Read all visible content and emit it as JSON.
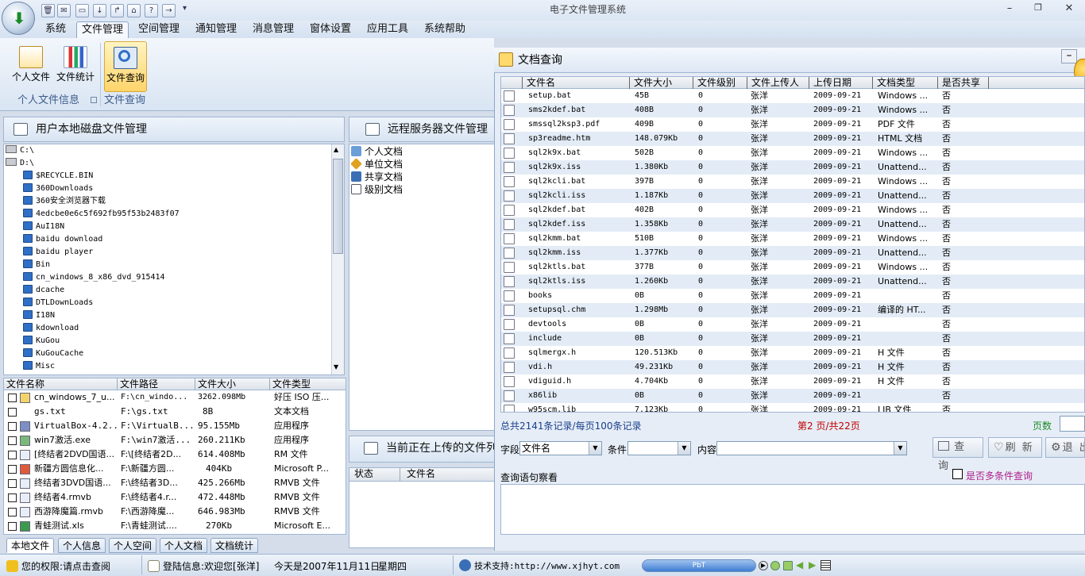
{
  "app": {
    "title": "电子文件管理系统"
  },
  "menu": [
    "系统",
    "文件管理",
    "空间管理",
    "通知管理",
    "消息管理",
    "窗体设置",
    "应用工具",
    "系统帮助"
  ],
  "ribbon": {
    "buttons": {
      "personal": "个人文件",
      "stats": "文件统计",
      "query": "文件查询"
    },
    "groups": {
      "personal_info": "个人文件信息",
      "query": "文件查询"
    }
  },
  "local_panel": {
    "title": "用户本地磁盘文件管理",
    "drives": [
      "C:\\",
      "D:\\"
    ],
    "folders": [
      "$RECYCLE.BIN",
      "360Downloads",
      "360安全浏览器下载",
      "4edcbe0e6c5f692fb95f53b2483f07",
      "AuI18N",
      "baidu download",
      "baidu player",
      "Bin",
      "cn_windows_8_x86_dvd_915414",
      "dcache",
      "DTLDownLoads",
      "I18N",
      "kdownload",
      "KuGou",
      "KuGouCache",
      "Misc"
    ],
    "columns": [
      "文件名称",
      "文件路径",
      "文件大小",
      "文件类型"
    ],
    "files": [
      {
        "name": "cn_windows_7_u...",
        "path": "F:\\cn_windo...",
        "size": "3262.098Mb",
        "type": "好压 ISO 压..."
      },
      {
        "name": "gs.txt",
        "path": "F:\\gs.txt",
        "size": "8B",
        "type": "文本文档"
      },
      {
        "name": "VirtualBox-4.2...",
        "path": "F:\\VirtualB...",
        "size": "95.155Mb",
        "type": "应用程序"
      },
      {
        "name": "win7激活.exe",
        "path": "F:\\win7激活...",
        "size": "260.211Kb",
        "type": "应用程序"
      },
      {
        "name": "[终结者2DVD国语...",
        "path": "F:\\[终结者2D...",
        "size": "614.408Mb",
        "type": "RM 文件"
      },
      {
        "name": "新疆方圆信息化...",
        "path": "F:\\新疆方圆...",
        "size": "404Kb",
        "type": "Microsoft P..."
      },
      {
        "name": "终结者3DVD国语...",
        "path": "F:\\终结者3D...",
        "size": "425.266Mb",
        "type": "RMVB 文件"
      },
      {
        "name": "终结者4.rmvb",
        "path": "F:\\终结者4.r...",
        "size": "472.448Mb",
        "type": "RMVB 文件"
      },
      {
        "name": "西游降魔篇.rmvb",
        "path": "F:\\西游降魔...",
        "size": "646.983Mb",
        "type": "RMVB 文件"
      },
      {
        "name": "青蛙测试.xls",
        "path": "F:\\青蛙测试....",
        "size": "270Kb",
        "type": "Microsoft E..."
      }
    ],
    "tabs": [
      "本地文件",
      "个人信息",
      "个人空间",
      "个人文档",
      "文档统计"
    ]
  },
  "remote_panel": {
    "title": "远程服务器文件管理",
    "items": [
      "个人文档",
      "单位文档",
      "共享文档",
      "级别文档"
    ],
    "upload_title": "当前正在上传的文件列",
    "upload_columns": [
      "状态",
      "文件名"
    ]
  },
  "doc_query": {
    "title": "文档查询",
    "columns": [
      "文件名",
      "文件大小",
      "文件级别",
      "文件上传人",
      "上传日期",
      "文档类型",
      "是否共享"
    ],
    "rows": [
      [
        "setup.bat",
        "45B",
        "0",
        "张洋",
        "2009-09-21",
        "Windows ...",
        "否"
      ],
      [
        "sms2kdef.bat",
        "408B",
        "0",
        "张洋",
        "2009-09-21",
        "Windows ...",
        "否"
      ],
      [
        "smssql2ksp3.pdf",
        "409B",
        "0",
        "张洋",
        "2009-09-21",
        "PDF 文件",
        "否"
      ],
      [
        "sp3readme.htm",
        "148.079Kb",
        "0",
        "张洋",
        "2009-09-21",
        "HTML 文档",
        "否"
      ],
      [
        "sql2k9x.bat",
        "502B",
        "0",
        "张洋",
        "2009-09-21",
        "Windows ...",
        "否"
      ],
      [
        "sql2k9x.iss",
        "1.380Kb",
        "0",
        "张洋",
        "2009-09-21",
        "Unattend...",
        "否"
      ],
      [
        "sql2kcli.bat",
        "397B",
        "0",
        "张洋",
        "2009-09-21",
        "Windows ...",
        "否"
      ],
      [
        "sql2kcli.iss",
        "1.187Kb",
        "0",
        "张洋",
        "2009-09-21",
        "Unattend...",
        "否"
      ],
      [
        "sql2kdef.bat",
        "402B",
        "0",
        "张洋",
        "2009-09-21",
        "Windows ...",
        "否"
      ],
      [
        "sql2kdef.iss",
        "1.358Kb",
        "0",
        "张洋",
        "2009-09-21",
        "Unattend...",
        "否"
      ],
      [
        "sql2kmm.bat",
        "510B",
        "0",
        "张洋",
        "2009-09-21",
        "Windows ...",
        "否"
      ],
      [
        "sql2kmm.iss",
        "1.377Kb",
        "0",
        "张洋",
        "2009-09-21",
        "Unattend...",
        "否"
      ],
      [
        "sql2ktls.bat",
        "377B",
        "0",
        "张洋",
        "2009-09-21",
        "Windows ...",
        "否"
      ],
      [
        "sql2ktls.iss",
        "1.260Kb",
        "0",
        "张洋",
        "2009-09-21",
        "Unattend...",
        "否"
      ],
      [
        "books",
        "0B",
        "0",
        "张洋",
        "2009-09-21",
        "",
        "否"
      ],
      [
        "setupsql.chm",
        "1.298Mb",
        "0",
        "张洋",
        "2009-09-21",
        "编译的 HT...",
        "否"
      ],
      [
        "devtools",
        "0B",
        "0",
        "张洋",
        "2009-09-21",
        "",
        "否"
      ],
      [
        "include",
        "0B",
        "0",
        "张洋",
        "2009-09-21",
        "",
        "否"
      ],
      [
        "sqlmergx.h",
        "120.513Kb",
        "0",
        "张洋",
        "2009-09-21",
        "H 文件",
        "否"
      ],
      [
        "vdi.h",
        "49.231Kb",
        "0",
        "张洋",
        "2009-09-21",
        "H 文件",
        "否"
      ],
      [
        "vdiguid.h",
        "4.704Kb",
        "0",
        "张洋",
        "2009-09-21",
        "H 文件",
        "否"
      ],
      [
        "x86lib",
        "0B",
        "0",
        "张洋",
        "2009-09-21",
        "",
        "否"
      ],
      [
        "w95scm.lib",
        "7.123Kb",
        "0",
        "张洋",
        "2009-09-21",
        "LIB 文件",
        "否"
      ]
    ],
    "summary": "总共2141条记录/每页100条记录",
    "page_info": "第2 页/共22页",
    "page_label": "页数",
    "field_label": "字段",
    "field_value": "文件名",
    "cond_label": "条件",
    "content_label": "内容",
    "btn_query": "查 询",
    "btn_refresh": "刷 新",
    "btn_exit": "退 出",
    "stmt_label": "查询语句察看",
    "multi_label": "是否多条件查询"
  },
  "status": {
    "perm": "您的权限:请点击查阅",
    "login": "登陆信息:欢迎您[张洋]",
    "date": "今天是2007年11月11日",
    "weekday": "星期四",
    "support": "技术支持:http://www.xjhyt.com",
    "pbt": "PbT"
  },
  "colors": {
    "accent": "#2f6fc6",
    "highlight": "#ffd46a",
    "link": "#b01e8c",
    "page_red": "#c00000",
    "page_green": "#1b8a2a"
  }
}
